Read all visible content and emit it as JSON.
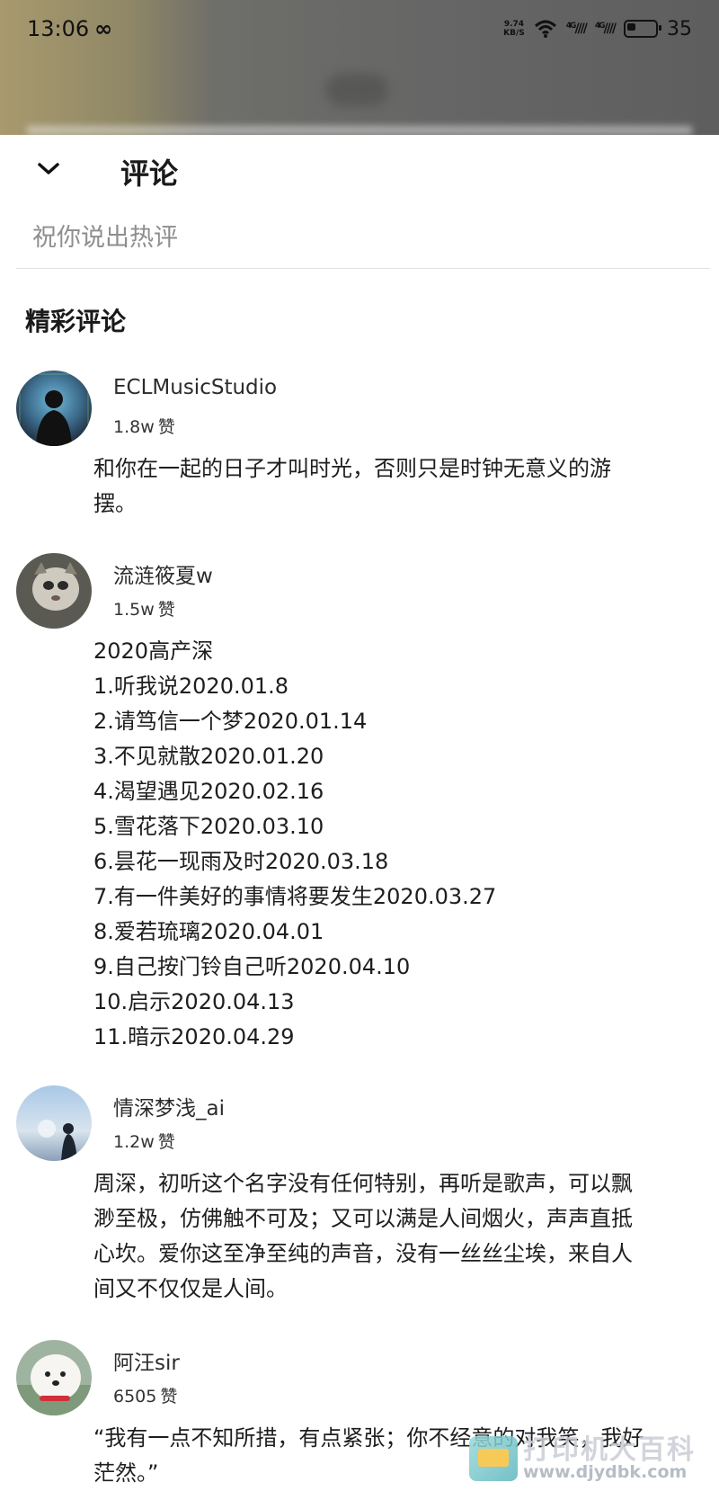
{
  "status_bar": {
    "time": "13:06",
    "net_speed_value": "9.74",
    "net_speed_unit": "KB/S",
    "signal_1_label": "4G",
    "signal_2_label": "4G",
    "battery": "35"
  },
  "header": {
    "title": "评论"
  },
  "comment_input": {
    "placeholder": "祝你说出热评"
  },
  "section": {
    "title": "精彩评论"
  },
  "comments": [
    {
      "username": "ECLMusicStudio",
      "likes": "1.8w",
      "like_unit": "赞",
      "content": "和你在一起的日子才叫时光，否则只是时钟无意义的游\n摆。"
    },
    {
      "username": "流涟筱夏w",
      "likes": "1.5w",
      "like_unit": "赞",
      "content": "2020高产深\n1.听我说2020.01.8\n2.请笃信一个梦2020.01.14\n3.不见就散2020.01.20\n4.渴望遇见2020.02.16\n5.雪花落下2020.03.10\n6.昙花一现雨及时2020.03.18\n7.有一件美好的事情将要发生2020.03.27\n8.爱若琉璃2020.04.01\n9.自己按门铃自己听2020.04.10\n10.启示2020.04.13\n11.暗示2020.04.29"
    },
    {
      "username": "情深梦浅_ai",
      "likes": "1.2w",
      "like_unit": "赞",
      "content": "周深，初听这个名字没有任何特别，再听是歌声，可以飘\n渺至极，仿佛触不可及；又可以满是人间烟火，声声直抵\n心坎。爱你这至净至纯的声音，没有一丝丝尘埃，来自人\n间又不仅仅是人间。"
    },
    {
      "username": "阿汪sir",
      "likes": "6505",
      "like_unit": "赞",
      "content": "“我有一点不知所措，有点紧张；你不经意的对我笑，我好\n茫然。”"
    }
  ],
  "watermark": {
    "cn": "打印机大百科",
    "url": "www.djydbk.com"
  }
}
